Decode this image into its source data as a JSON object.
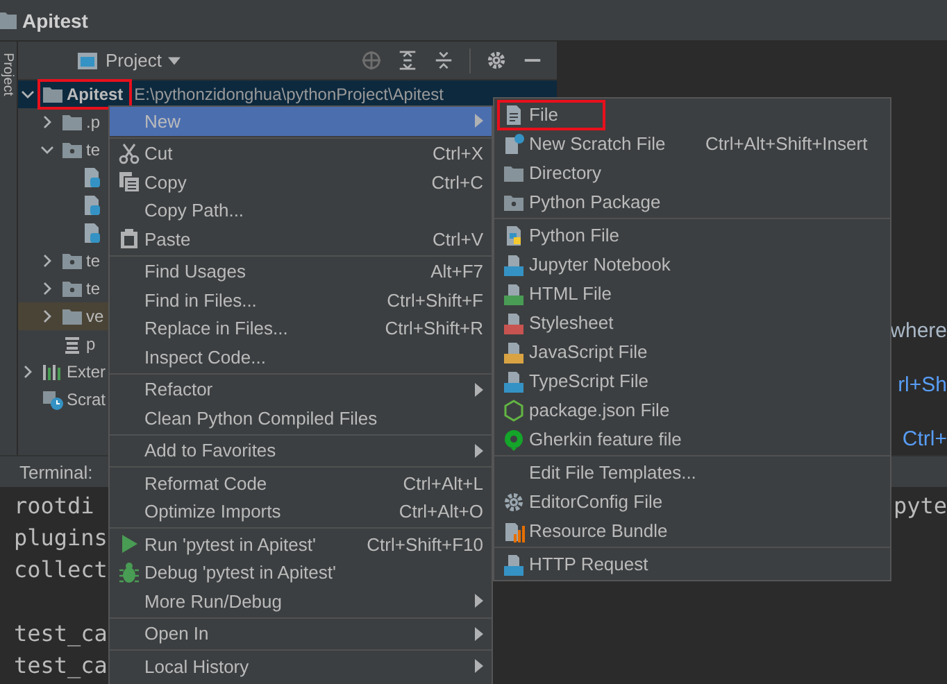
{
  "window": {
    "title": "Apitest"
  },
  "side_strip": {
    "label": "Project"
  },
  "project_panel": {
    "title": "Project"
  },
  "tree": [
    {
      "label": "Apitest",
      "detail": "E:\\pythonzidonghua\\pythonProject\\Apitest",
      "kind": "folder",
      "expanded": true,
      "selected": true,
      "highlighted": true,
      "excluded": false,
      "children": [
        {
          "label": ".p",
          "kind": "folder",
          "expanded": false,
          "selected": false,
          "highlighted": false,
          "excluded": false
        },
        {
          "label": "te",
          "kind": "package",
          "expanded": true,
          "selected": false,
          "highlighted": false,
          "excluded": false,
          "children": [
            {
              "kind": "pyfile",
              "selected": false,
              "highlighted": false,
              "excluded": false
            },
            {
              "kind": "pyfile",
              "selected": false,
              "highlighted": false,
              "excluded": false
            },
            {
              "kind": "pyfile",
              "selected": false,
              "highlighted": false,
              "excluded": false
            }
          ]
        },
        {
          "label": "te",
          "kind": "package",
          "expanded": false,
          "selected": false,
          "highlighted": false,
          "excluded": false
        },
        {
          "label": "te",
          "kind": "package",
          "expanded": false,
          "selected": false,
          "highlighted": false,
          "excluded": false
        },
        {
          "label": "ve",
          "kind": "folder",
          "expanded": false,
          "selected": false,
          "highlighted": false,
          "excluded": true
        },
        {
          "label": "p",
          "kind": "requirements",
          "selected": false,
          "highlighted": false,
          "excluded": false
        }
      ]
    },
    {
      "label": "Exter",
      "kind": "libraries",
      "expanded": false,
      "selected": false,
      "highlighted": false,
      "excluded": false
    },
    {
      "label": "Scrat",
      "kind": "scratches",
      "selected": false,
      "highlighted": false,
      "excluded": false
    }
  ],
  "editor_fragments": [
    {
      "text": "where",
      "kind": "plain"
    },
    {
      "text": "rl+Sh",
      "kind": "link"
    },
    {
      "text": "Ctrl+",
      "kind": "link"
    }
  ],
  "terminal": {
    "title": "Terminal:",
    "blocks": [
      [
        {
          "text": "rootdi",
          "right": "pyte"
        },
        {
          "text": "plugins"
        },
        {
          "text": "collect"
        }
      ],
      [
        {
          "text": "test_ca"
        },
        {
          "text": "test_ca"
        }
      ]
    ]
  },
  "context_menu": {
    "groups": [
      [
        {
          "label": "New",
          "kind": "plain",
          "submenu": true,
          "selected": true
        }
      ],
      [
        {
          "label": "Cut",
          "shortcut": "Ctrl+X",
          "kind": "cut",
          "selected": false
        },
        {
          "label": "Copy",
          "shortcut": "Ctrl+C",
          "kind": "copy",
          "selected": false
        },
        {
          "label": "Copy Path...",
          "kind": "plain",
          "selected": false
        },
        {
          "label": "Paste",
          "shortcut": "Ctrl+V",
          "kind": "paste",
          "selected": false
        }
      ],
      [
        {
          "label": "Find Usages",
          "shortcut": "Alt+F7",
          "kind": "plain",
          "selected": false
        },
        {
          "label": "Find in Files...",
          "shortcut": "Ctrl+Shift+F",
          "kind": "plain",
          "selected": false
        },
        {
          "label": "Replace in Files...",
          "shortcut": "Ctrl+Shift+R",
          "kind": "plain",
          "selected": false
        },
        {
          "label": "Inspect Code...",
          "kind": "plain",
          "selected": false
        }
      ],
      [
        {
          "label": "Refactor",
          "kind": "plain",
          "submenu": true,
          "selected": false
        },
        {
          "label": "Clean Python Compiled Files",
          "kind": "plain",
          "selected": false
        }
      ],
      [
        {
          "label": "Add to Favorites",
          "kind": "plain",
          "submenu": true,
          "selected": false
        }
      ],
      [
        {
          "label": "Reformat Code",
          "shortcut": "Ctrl+Alt+L",
          "kind": "plain",
          "selected": false
        },
        {
          "label": "Optimize Imports",
          "shortcut": "Ctrl+Alt+O",
          "kind": "plain",
          "selected": false
        }
      ],
      [
        {
          "label": "Run 'pytest in Apitest'",
          "shortcut": "Ctrl+Shift+F10",
          "kind": "run",
          "selected": false
        },
        {
          "label": "Debug 'pytest in Apitest'",
          "kind": "debug",
          "selected": false
        },
        {
          "label": "More Run/Debug",
          "kind": "plain",
          "submenu": true,
          "selected": false
        }
      ],
      [
        {
          "label": "Open In",
          "kind": "plain",
          "submenu": true,
          "selected": false
        }
      ],
      [
        {
          "label": "Local History",
          "kind": "plain",
          "submenu": true,
          "selected": false
        }
      ]
    ]
  },
  "new_submenu": {
    "groups": [
      [
        {
          "label": "File",
          "kind": "file",
          "highlighted": true
        },
        {
          "label": "New Scratch File",
          "shortcut": "Ctrl+Alt+Shift+Insert",
          "kind": "scratch",
          "highlighted": false
        },
        {
          "label": "Directory",
          "kind": "folder",
          "highlighted": false
        },
        {
          "label": "Python Package",
          "kind": "package",
          "highlighted": false
        }
      ],
      [
        {
          "label": "Python File",
          "kind": "python",
          "highlighted": false
        },
        {
          "label": "Jupyter Notebook",
          "kind": "jupyter",
          "highlighted": false
        },
        {
          "label": "HTML File",
          "kind": "html",
          "highlighted": false
        },
        {
          "label": "Stylesheet",
          "kind": "css",
          "highlighted": false
        },
        {
          "label": "JavaScript File",
          "kind": "js",
          "highlighted": false
        },
        {
          "label": "TypeScript File",
          "kind": "ts",
          "highlighted": false
        },
        {
          "label": "package.json File",
          "kind": "npm",
          "highlighted": false
        },
        {
          "label": "Gherkin feature file",
          "kind": "gherkin",
          "highlighted": false
        }
      ],
      [
        {
          "label": "Edit File Templates...",
          "kind": "plain",
          "highlighted": false
        },
        {
          "label": "EditorConfig File",
          "kind": "gear",
          "highlighted": false
        },
        {
          "label": "Resource Bundle",
          "kind": "bundle",
          "highlighted": false
        }
      ],
      [
        {
          "label": "HTTP Request",
          "kind": "api",
          "highlighted": false
        }
      ]
    ]
  }
}
